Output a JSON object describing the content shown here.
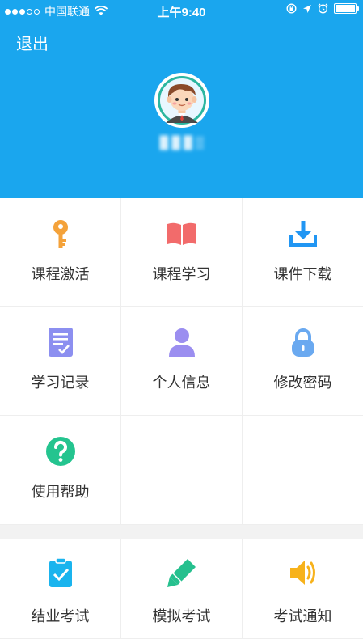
{
  "status_bar": {
    "carrier": "中国联通",
    "time": "上午9:40"
  },
  "header": {
    "logout_label": "退出",
    "username": "█ █ █ ▒"
  },
  "menu": {
    "course_activate": "课程激活",
    "course_study": "课程学习",
    "courseware_download": "课件下载",
    "study_record": "学习记录",
    "personal_info": "个人信息",
    "change_password": "修改密码",
    "help": "使用帮助"
  },
  "exam": {
    "completion_exam": "结业考试",
    "mock_exam": "模拟考试",
    "exam_notice": "考试通知"
  },
  "colors": {
    "header_bg": "#1aa6ee",
    "key_icon": "#f4a23a",
    "book_icon": "#f26b6b",
    "download_icon": "#2196f3",
    "record_icon": "#8c8ff0",
    "person_icon": "#9b8ef0",
    "lock_icon": "#6aa9f0",
    "help_icon": "#24c48f",
    "clipboard_icon": "#1ab4ee",
    "pencil_icon": "#26c08e",
    "speaker_icon": "#f7b21b"
  }
}
